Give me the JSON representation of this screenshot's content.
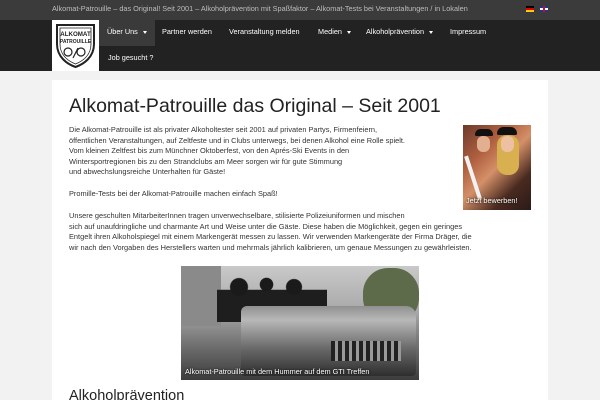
{
  "topbar": {
    "tagline": "Alkomat-Patrouille – das Original! Seit 2001 – Alkoholprävention mit Spaßfaktor – Alkomat-Tests bei Veranstaltungen / in Lokalen"
  },
  "logo": {
    "line1": "ALKOMAT",
    "line2": "PATROUILLE"
  },
  "nav": {
    "items": [
      {
        "label": "Über Uns",
        "has_dropdown": true,
        "active": true
      },
      {
        "label": "Partner werden",
        "has_dropdown": false
      },
      {
        "label": "Veranstaltung melden",
        "has_dropdown": false
      },
      {
        "label": "Medien",
        "has_dropdown": true
      },
      {
        "label": "Alkoholprävention",
        "has_dropdown": true
      },
      {
        "label": "Impressum",
        "has_dropdown": false
      },
      {
        "label": "Job gesucht ?",
        "has_dropdown": false
      }
    ]
  },
  "page": {
    "title": "Alkomat-Patrouille das Original – Seit 2001",
    "intro_lines": [
      "Die Alkomat-Patrouille ist als privater Alkoholtester seit 2001 auf privaten Partys, Firmenfeiern,",
      "öffentlichen Veranstaltungen, auf Zeltfeste und in Clubs unterwegs, bei denen Alkohol eine Rolle spielt.",
      "Vom kleinen Zeltfest bis zum Münchner Oktoberfest, von den Aprés-Ski Events in den",
      "Wintersportregionen bis zu den Strandclubs am Meer sorgen wir für gute Stimmung",
      "und abwechslungsreiche Unterhalten für Gäste!"
    ],
    "fun_line": "Promille-Tests bei der Alkomat-Patrouille machen einfach Spaß!",
    "staff_lines": [
      "Unsere geschulten MitarbeiterInnen tragen unverwechselbare, stilisierte Polizeiuniformen und mischen",
      "sich auf unaufdringliche und charmante Art und Weise unter die Gäste. Diese haben die Möglichkeit, gegen ein geringes",
      "Entgelt ihren Alkoholspiegel mit einem Markengerät messen zu lassen. Wir verwenden Markengeräte der Firma Dräger, die",
      "wir nach den Vorgaben des Herstellers warten und mehrmals jährlich kalibrieren, um genaue Messungen zu gewährleisten."
    ],
    "side_photo_caption": "Jetzt bewerben!",
    "main_photo_caption": "Alkomat-Patrouille mit dem Hummer auf dem GTI Treffen",
    "section_heading": "Alkoholprävention"
  },
  "colors": {
    "topbar_bg": "#3b3b3b",
    "navbar_bg": "#222222",
    "active_nav_bg": "#3a3a3a",
    "page_bg": "#f2f2f2",
    "content_bg": "#ffffff"
  }
}
